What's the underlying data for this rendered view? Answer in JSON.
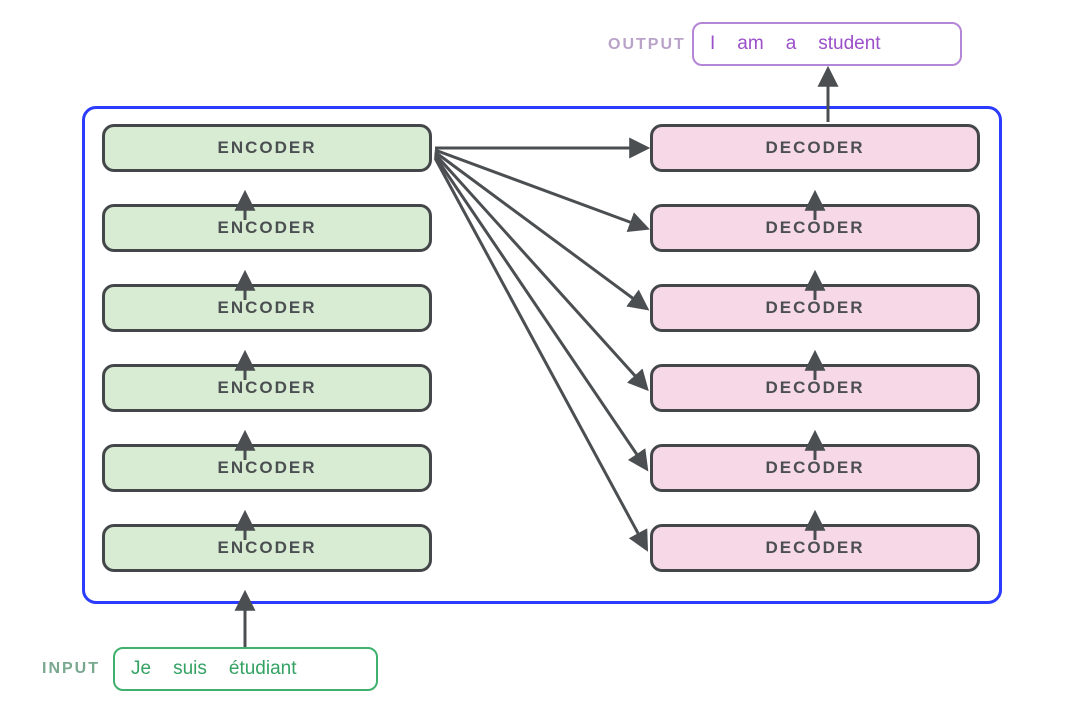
{
  "labels": {
    "input": "INPUT",
    "output": "OUTPUT"
  },
  "input_tokens": [
    "Je",
    "suis",
    "étudiant"
  ],
  "output_tokens": [
    "I",
    "am",
    "a",
    "student"
  ],
  "encoder": {
    "label": "ENCODER",
    "count": 6
  },
  "decoder": {
    "label": "DECODER",
    "count": 6
  },
  "colors": {
    "model_border": "#2b3bff",
    "encoder_bg": "#d8ecd4",
    "decoder_bg": "#f7d8e6",
    "block_border": "#43474a",
    "input_accent": "#3fb06e",
    "output_accent": "#b486d6",
    "arrow": "#4b4f52"
  }
}
